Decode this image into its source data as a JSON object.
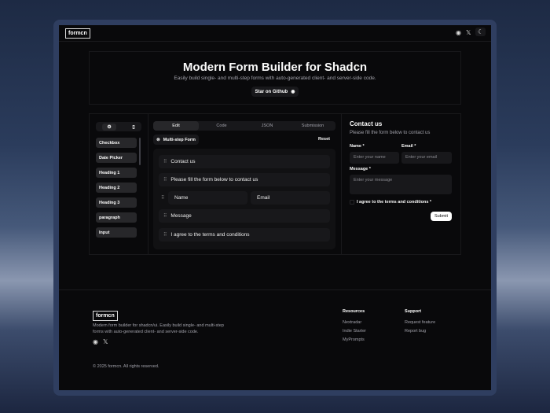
{
  "header": {
    "logo": "formcn",
    "icons": [
      "github-icon",
      "x-icon",
      "theme-toggle-icon"
    ]
  },
  "hero": {
    "title": "Modern Form Builder for Shadcn",
    "subtitle": "Easily build single- and multi-step forms with auto-generated client- and server-side code.",
    "star_button": "Star on Github"
  },
  "sidebar": {
    "items": [
      "Checkbox",
      "Date Picker",
      "Heading 1",
      "Heading 2",
      "Heading 3",
      "paragraph",
      "Input"
    ]
  },
  "editor": {
    "tabs": [
      "Edit",
      "Code",
      "JSON",
      "Submission"
    ],
    "active_tab": "Edit",
    "multistep_button": "Multi-step Form",
    "reset_button": "Reset",
    "fields": [
      "Contact us",
      "Please fill the form below to contact us",
      "Message",
      "I agree to the terms and conditions"
    ],
    "row_fields": [
      "Name",
      "Email"
    ]
  },
  "preview": {
    "title": "Contact us",
    "description": "Please fill the form below to contact us",
    "name_label": "Name *",
    "name_placeholder": "Enter your name",
    "email_label": "Email *",
    "email_placeholder": "Enter your email",
    "message_label": "Message *",
    "message_placeholder": "Enter your message",
    "checkbox_label": "I agree to the terms and conditions *",
    "submit": "Submit"
  },
  "footer": {
    "logo": "formcn",
    "description": "Modern form builder for shadcn/ui. Easily build single- and multi-step forms with auto-generated client- and server-side code.",
    "resources_title": "Resources",
    "resources": [
      "Nextradar",
      "Indie Starter",
      "MyPrompts"
    ],
    "support_title": "Support",
    "support": [
      "Request feature",
      "Report bug"
    ],
    "copyright": "© 2025 formcn. All rights reserved."
  }
}
